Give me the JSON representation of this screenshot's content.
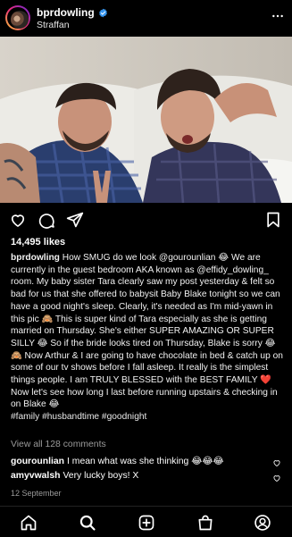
{
  "post": {
    "username": "bprdowling",
    "location": "Straffan",
    "likes": "14,495 likes",
    "caption_username": "bprdowling",
    "caption_text": "How SMUG do we look @gourounlian 😂 We are currently in the guest bedroom AKA known as @effidy_dowling_ room. My baby sister Tara clearly saw my post yesterday & felt so bad for us that she offered to babysit Baby Blake tonight so we can have a good night's sleep. Clearly, it's needed as I'm mid-yawn in this pic 🙈 This is super kind of Tara especially as she is getting married on Thursday. She's either SUPER AMAZING OR SUPER SILLY 😂 So if the bride looks tired on Thursday, Blake is sorry 😂 🙈 Now Arthur & I are going to have chocolate in bed & catch up on some of our tv shows before I fall asleep. It really is the simplest things people. I am TRULY BLESSED with the BEST FAMILY ❤️ Now let's see how long I last before running upstairs & checking in on Blake 😂",
    "hashtags": "#family #husbandtime #goodnight",
    "view_all": "View all 128 comments",
    "comments": [
      {
        "user": "gourounlian",
        "text": "I mean what was she thinking 😂😂😂"
      },
      {
        "user": "amyvwalsh",
        "text": "Very lucky boys! X"
      }
    ],
    "date": "12 September"
  },
  "icons": {
    "verified": "verified-badge-icon",
    "more": "more-options-icon",
    "like": "heart-icon",
    "comment": "comment-icon",
    "share": "share-icon",
    "save": "bookmark-icon",
    "nav": [
      "home-icon",
      "search-icon",
      "add-post-icon",
      "shop-icon",
      "profile-icon"
    ]
  },
  "colors": {
    "background": "#000000",
    "text": "#ffffff",
    "muted": "#9b9b9b",
    "verified": "#3897f0"
  }
}
